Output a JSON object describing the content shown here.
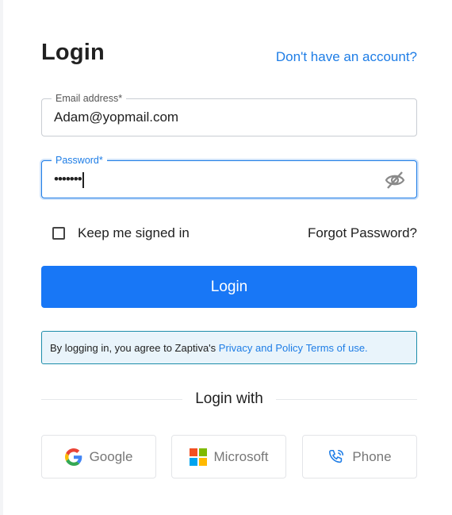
{
  "header": {
    "title": "Login",
    "signup_link": "Don't have an account?"
  },
  "form": {
    "email": {
      "label": "Email address*",
      "value": "Adam@yopmail.com"
    },
    "password": {
      "label": "Password*",
      "masked_value": "•••••••"
    },
    "remember_label": "Keep me signed in",
    "forgot_label": "Forgot Password?",
    "submit_label": "Login"
  },
  "notice": {
    "prefix": "By logging in, you agree to Zaptiva's ",
    "privacy_link": "Privacy and Policy",
    "terms_link": "Terms of use."
  },
  "social": {
    "divider_text": "Login with",
    "buttons": [
      {
        "label": "Google",
        "icon": "google-icon"
      },
      {
        "label": "Microsoft",
        "icon": "microsoft-icon"
      },
      {
        "label": "Phone",
        "icon": "phone-icon"
      }
    ]
  },
  "colors": {
    "primary": "#1877f6",
    "link": "#1e7de6",
    "notice_bg": "#e9f4fb",
    "notice_border": "#1d8daa"
  }
}
